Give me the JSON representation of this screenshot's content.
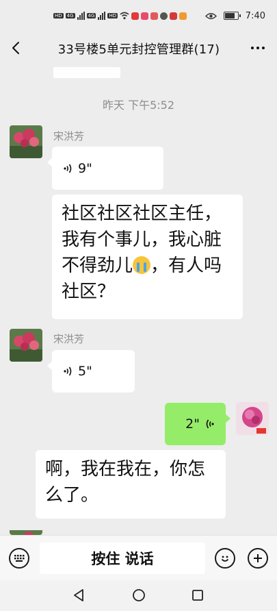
{
  "status_bar": {
    "tags": [
      "HD",
      "4G",
      "4G",
      "HD"
    ],
    "time": "7:40"
  },
  "header": {
    "title": "33号楼5单元封控管理群(17)"
  },
  "timestamp": "昨天 下午5:52",
  "messages": [
    {
      "sender": "宋洪芳",
      "voice_duration": "9\""
    },
    {
      "text_before_emoji": "社区社区社区主任，我有个事儿，我心脏不得劲儿",
      "text_after_emoji": "，有人吗社区？"
    },
    {
      "sender": "宋洪芳",
      "voice_duration": "5\""
    },
    {
      "voice_duration": "2\""
    },
    {
      "text": "啊，我在我在，你怎么了。"
    }
  ],
  "input_bar": {
    "hold_to_talk_label": "按住 说话"
  },
  "colors": {
    "background": "#ededed",
    "outgoing_bubble": "#95ec69",
    "incoming_bubble": "#ffffff"
  }
}
